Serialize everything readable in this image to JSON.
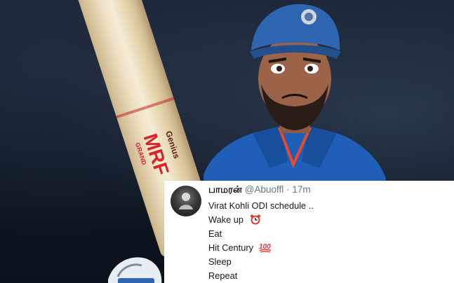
{
  "tweet": {
    "display_name": "பாமரன்",
    "handle": "@Abuoffl",
    "separator": "·",
    "time": "17m",
    "lines": [
      {
        "text": "Virat Kohli ODI schedule ..",
        "icon": ""
      },
      {
        "text": "Wake up",
        "icon": "alarm-clock-icon"
      },
      {
        "text": "Eat",
        "icon": ""
      },
      {
        "text": "Hit Century",
        "icon": "hundred-points-icon"
      },
      {
        "text": "Sleep",
        "icon": ""
      },
      {
        "text": "Repeat",
        "icon": ""
      }
    ]
  },
  "bat": {
    "brand_text": "MRF",
    "model_text": "Genius",
    "series_text": "GRAND"
  },
  "colors": {
    "jersey": "#1f5fb8",
    "cap": "#2f66b2",
    "bat_logo_red": "#d9242b",
    "tweet_text": "#14171a",
    "tweet_meta": "#657786"
  }
}
